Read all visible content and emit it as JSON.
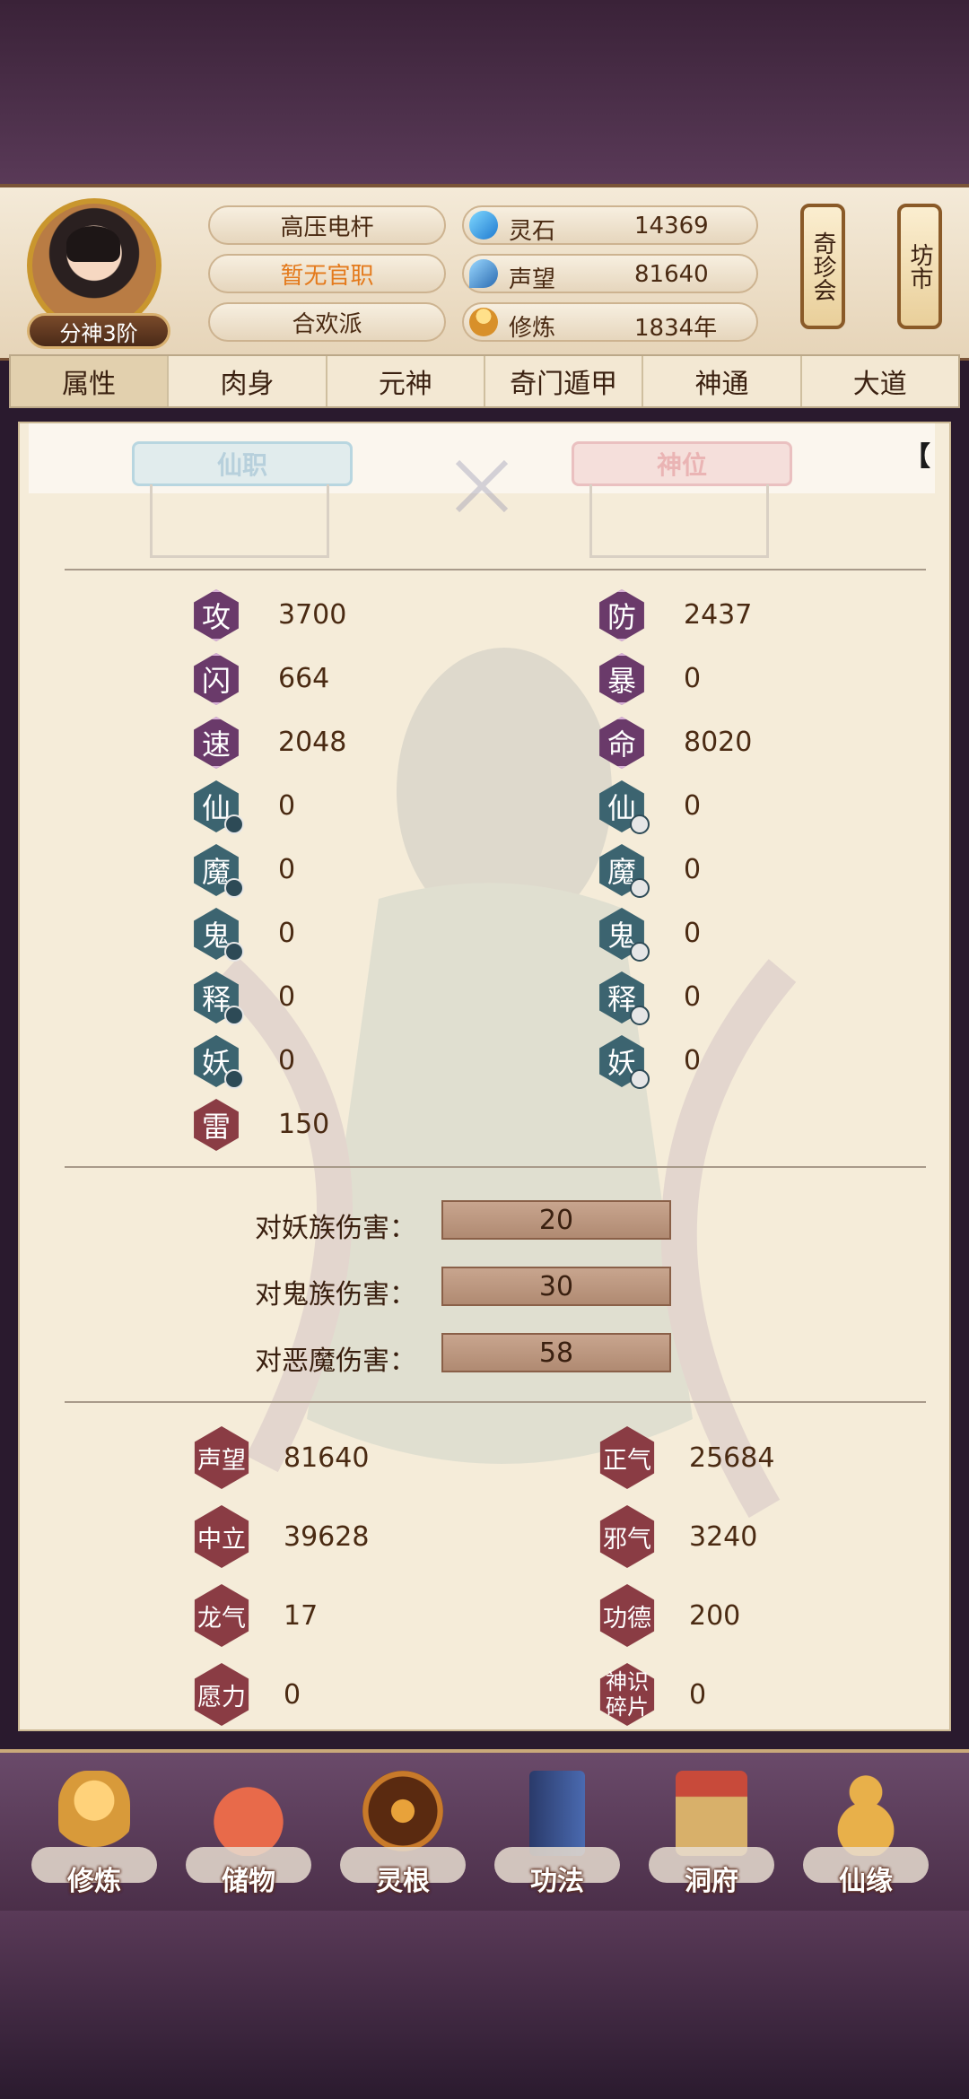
{
  "header": {
    "rank_badge": "分神3阶",
    "character_name": "高压电杆",
    "official_title": "暂无官职",
    "sect": "合欢派",
    "resources": [
      {
        "label": "灵石",
        "value": "14369",
        "icon": "spirit-stone-icon"
      },
      {
        "label": "声望",
        "value": "81640",
        "icon": "reputation-icon"
      },
      {
        "label": "修炼",
        "value": "1834年",
        "icon": "cultivation-icon"
      }
    ],
    "side_buttons": [
      {
        "label": "奇珍会"
      },
      {
        "label": "坊市"
      }
    ]
  },
  "tabs": [
    {
      "label": "属性",
      "active": true
    },
    {
      "label": "肉身",
      "active": false
    },
    {
      "label": "元神",
      "active": false
    },
    {
      "label": "奇门遁甲",
      "active": false
    },
    {
      "label": "神通",
      "active": false
    },
    {
      "label": "大道",
      "active": false
    }
  ],
  "positions": {
    "immortal_post": "仙职",
    "divine_post": "神位",
    "bracket_text": "【"
  },
  "stats_left": [
    {
      "icon": "攻",
      "value": "3700",
      "kind": "purple"
    },
    {
      "icon": "闪",
      "value": "664",
      "kind": "purple"
    },
    {
      "icon": "速",
      "value": "2048",
      "kind": "purple"
    },
    {
      "icon": "仙",
      "value": "0",
      "kind": "teal"
    },
    {
      "icon": "魔",
      "value": "0",
      "kind": "teal"
    },
    {
      "icon": "鬼",
      "value": "0",
      "kind": "teal"
    },
    {
      "icon": "释",
      "value": "0",
      "kind": "teal"
    },
    {
      "icon": "妖",
      "value": "0",
      "kind": "teal"
    },
    {
      "icon": "雷",
      "value": "150",
      "kind": "red"
    }
  ],
  "stats_right": [
    {
      "icon": "防",
      "value": "2437",
      "kind": "purple"
    },
    {
      "icon": "暴",
      "value": "0",
      "kind": "purple"
    },
    {
      "icon": "命",
      "value": "8020",
      "kind": "purple"
    },
    {
      "icon": "仙",
      "value": "0",
      "kind": "teal"
    },
    {
      "icon": "魔",
      "value": "0",
      "kind": "teal"
    },
    {
      "icon": "鬼",
      "value": "0",
      "kind": "teal"
    },
    {
      "icon": "释",
      "value": "0",
      "kind": "teal"
    },
    {
      "icon": "妖",
      "value": "0",
      "kind": "teal"
    }
  ],
  "damage": [
    {
      "label": "对妖族伤害：",
      "value": "20"
    },
    {
      "label": "对鬼族伤害：",
      "value": "30"
    },
    {
      "label": "对恶魔伤害：",
      "value": "58"
    }
  ],
  "reputation_left": [
    {
      "label": "声望",
      "value": "81640"
    },
    {
      "label": "中立",
      "value": "39628"
    },
    {
      "label": "龙气",
      "value": "17"
    },
    {
      "label": "愿力",
      "value": "0"
    }
  ],
  "reputation_right": [
    {
      "label": "正气",
      "value": "25684"
    },
    {
      "label": "邪气",
      "value": "3240"
    },
    {
      "label": "功德",
      "value": "200"
    },
    {
      "label": "神识碎片",
      "value": "0"
    }
  ],
  "nav": [
    {
      "label": "修炼",
      "icon": "cultivate-icon",
      "color": "#d89a3a"
    },
    {
      "label": "储物",
      "icon": "storage-bag-icon",
      "color": "#c84a3a"
    },
    {
      "label": "灵根",
      "icon": "spirit-root-icon",
      "color": "#9a4a1a"
    },
    {
      "label": "功法",
      "icon": "technique-book-icon",
      "color": "#3a5a9a"
    },
    {
      "label": "洞府",
      "icon": "cave-house-icon",
      "color": "#b8843a"
    },
    {
      "label": "仙缘",
      "icon": "gourd-icon",
      "color": "#d8a03a"
    }
  ]
}
